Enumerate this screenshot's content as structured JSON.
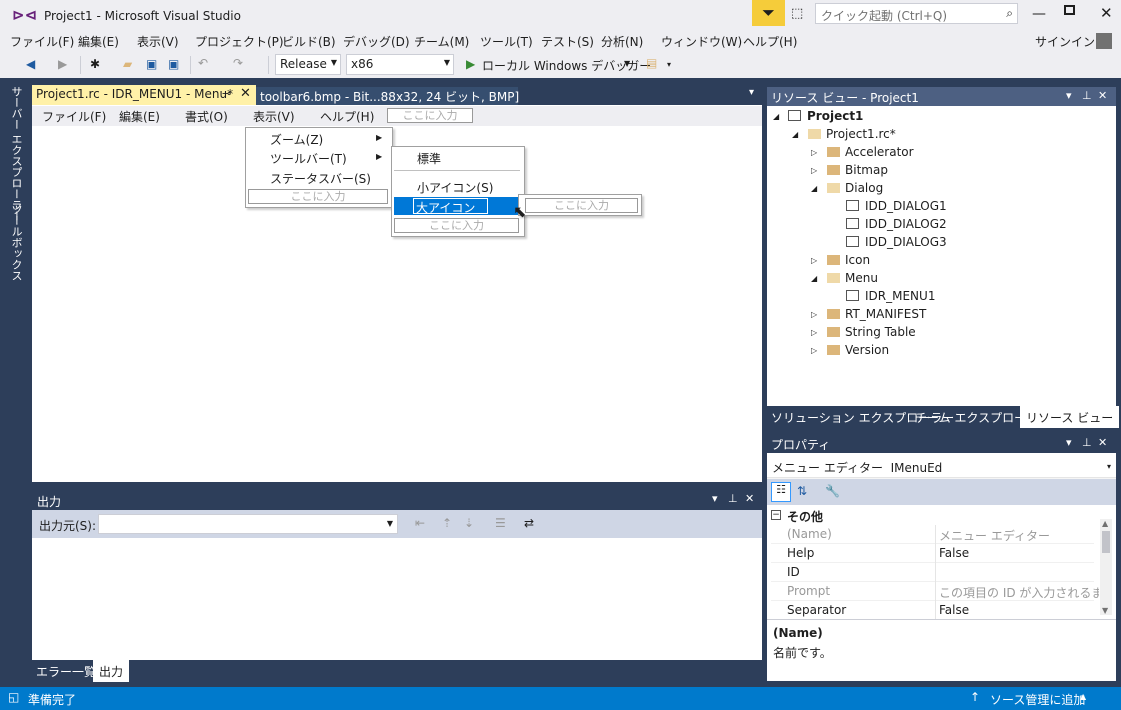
{
  "window": {
    "title": "Project1 - Microsoft Visual Studio",
    "quick_launch_placeholder": "クイック起動 (Ctrl+Q)",
    "signin": "サインイン"
  },
  "menu": [
    "ファイル(F)",
    "編集(E)",
    "表示(V)",
    "プロジェクト(P)",
    "ビルド(B)",
    "デバッグ(D)",
    "チーム(M)",
    "ツール(T)",
    "テスト(S)",
    "分析(N)",
    "ウィンドウ(W)",
    "ヘルプ(H)"
  ],
  "toolbar": {
    "config": "Release",
    "platform": "x86",
    "debugger": "ローカル Windows デバッガー"
  },
  "side_tabs": [
    "サーバー エクスプローラー",
    "ツールボックス"
  ],
  "editor": {
    "tab_active": "Project1.rc - IDR_MENU1 - Menu*",
    "tab_inactive": "toolbar6.bmp - Bit...88x32, 24 ビット, BMP]",
    "menu_items": [
      "ファイル(F)",
      "編集(E)",
      "書式(O)",
      "表示(V)",
      "ヘルプ(H)"
    ],
    "type_here": "ここに入力",
    "view_submenu": [
      "ズーム(Z)",
      "ツールバー(T)",
      "ステータスバー(S)"
    ],
    "toolbar_submenu": [
      "標準",
      "小アイコン(S)",
      "大アイコン(&B)"
    ]
  },
  "output": {
    "title": "出力",
    "source_label": "出力元(S):",
    "tabs": [
      "エラー一覧",
      "出力"
    ]
  },
  "resource_view": {
    "title": "リソース ビュー - Project1",
    "root": "Project1",
    "rc": "Project1.rc*",
    "folders": [
      "Accelerator",
      "Bitmap",
      "Dialog",
      "Icon",
      "Menu",
      "RT_MANIFEST",
      "String Table",
      "Version"
    ],
    "dialogs": [
      "IDD_DIALOG1",
      "IDD_DIALOG2",
      "IDD_DIALOG3"
    ],
    "menus": [
      "IDR_MENU1"
    ],
    "tabs": [
      "ソリューション エクスプローラー",
      "チーム エクスプローラー",
      "リソース ビュー"
    ]
  },
  "properties": {
    "title": "プロパティ",
    "object": "メニュー エディター  IMenuEd",
    "category": "その他",
    "rows": [
      {
        "name": "(Name)",
        "value": "メニュー エディター",
        "disabled": true
      },
      {
        "name": "Help",
        "value": "False",
        "disabled": false
      },
      {
        "name": "ID",
        "value": "",
        "disabled": false
      },
      {
        "name": "Prompt",
        "value": "この項目の ID が入力されるまでプ",
        "disabled": true
      },
      {
        "name": "Separator",
        "value": "False",
        "disabled": false
      }
    ],
    "desc_title": "(Name)",
    "desc_text": "名前です。"
  },
  "status": {
    "left": "準備完了",
    "right": "ソース管理に追加"
  },
  "colors": {
    "accent": "#007acc",
    "chrome": "#2d3e5a",
    "active_tab": "#fff1a8"
  }
}
